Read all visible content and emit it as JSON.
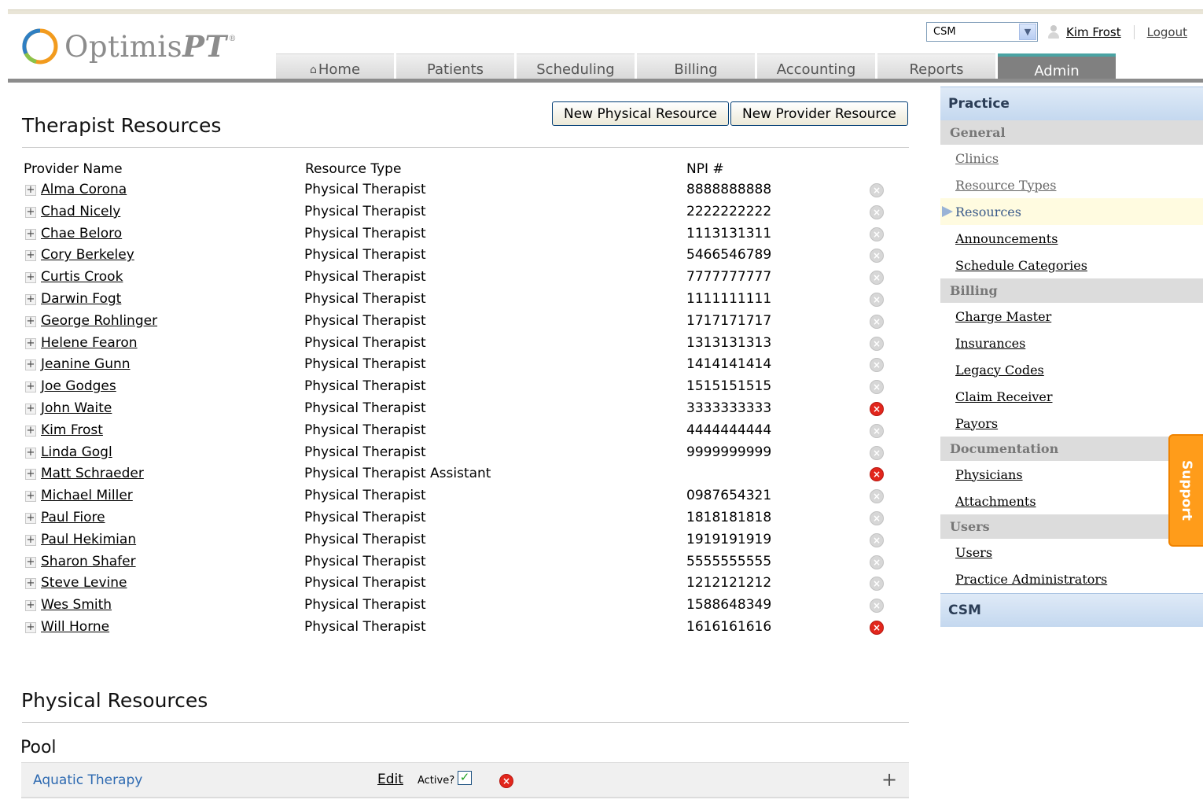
{
  "header": {
    "logo_text": "Optimis",
    "logo_text_pt": "PT",
    "logo_mark": "®",
    "csm_select_value": "CSM",
    "user_name": "Kim Frost",
    "logout_label": "Logout"
  },
  "nav": {
    "tabs": [
      {
        "label": "Home"
      },
      {
        "label": "Patients"
      },
      {
        "label": "Scheduling"
      },
      {
        "label": "Billing"
      },
      {
        "label": "Accounting"
      },
      {
        "label": "Reports"
      },
      {
        "label": "Admin"
      }
    ],
    "active": "Admin"
  },
  "therapist": {
    "title": "Therapist Resources",
    "new_physical_label": "New Physical Resource",
    "new_provider_label": "New Provider Resource",
    "col_provider": "Provider Name",
    "col_type": "Resource Type",
    "col_npi": "NPI #",
    "rows": [
      {
        "name": "Alma Corona",
        "type": "Physical Therapist",
        "npi": "8888888888",
        "active": true
      },
      {
        "name": "Chad Nicely",
        "type": "Physical Therapist",
        "npi": "2222222222",
        "active": true
      },
      {
        "name": "Chae Beloro",
        "type": "Physical Therapist",
        "npi": "1113131311",
        "active": true
      },
      {
        "name": "Cory Berkeley",
        "type": "Physical Therapist",
        "npi": "5466546789",
        "active": true
      },
      {
        "name": "Curtis Crook",
        "type": "Physical Therapist",
        "npi": "7777777777",
        "active": true
      },
      {
        "name": "Darwin Fogt",
        "type": "Physical Therapist",
        "npi": "1111111111",
        "active": true
      },
      {
        "name": "George Rohlinger",
        "type": "Physical Therapist",
        "npi": "1717171717",
        "active": true
      },
      {
        "name": "Helene Fearon",
        "type": "Physical Therapist",
        "npi": "1313131313",
        "active": true
      },
      {
        "name": "Jeanine Gunn",
        "type": "Physical Therapist",
        "npi": "1414141414",
        "active": true
      },
      {
        "name": "Joe Godges",
        "type": "Physical Therapist",
        "npi": "1515151515",
        "active": true
      },
      {
        "name": "John Waite",
        "type": "Physical Therapist",
        "npi": "3333333333",
        "active": false
      },
      {
        "name": "Kim Frost",
        "type": "Physical Therapist",
        "npi": "4444444444",
        "active": true
      },
      {
        "name": "Linda Gogl",
        "type": "Physical Therapist",
        "npi": "9999999999",
        "active": true
      },
      {
        "name": "Matt Schraeder",
        "type": "Physical Therapist Assistant",
        "npi": "",
        "active": false
      },
      {
        "name": "Michael Miller",
        "type": "Physical Therapist",
        "npi": "0987654321",
        "active": true
      },
      {
        "name": "Paul Fiore",
        "type": "Physical Therapist",
        "npi": "1818181818",
        "active": true
      },
      {
        "name": "Paul Hekimian",
        "type": "Physical Therapist",
        "npi": "1919191919",
        "active": true
      },
      {
        "name": "Sharon Shafer",
        "type": "Physical Therapist",
        "npi": "5555555555",
        "active": true
      },
      {
        "name": "Steve Levine",
        "type": "Physical Therapist",
        "npi": "1212121212",
        "active": true
      },
      {
        "name": "Wes Smith",
        "type": "Physical Therapist",
        "npi": "1588648349",
        "active": true
      },
      {
        "name": "Will Horne",
        "type": "Physical Therapist",
        "npi": "1616161616",
        "active": false
      }
    ]
  },
  "physical": {
    "title": "Physical Resources",
    "group_title": "Pool",
    "item_name": "Aquatic Therapy",
    "edit_label": "Edit",
    "active_label": "Active?"
  },
  "sidebar": {
    "practice_header": "Practice",
    "general_label": "General",
    "general_items": [
      "Clinics",
      "Resource Types",
      "Resources",
      "Announcements",
      "Schedule Categories"
    ],
    "billing_label": "Billing",
    "billing_items": [
      "Charge Master",
      "Insurances",
      "Legacy Codes",
      "Claim Receiver",
      "Payors"
    ],
    "documentation_label": "Documentation",
    "documentation_items": [
      "Physicians",
      "Attachments"
    ],
    "users_label": "Users",
    "users_items": [
      "Users",
      "Practice Administrators"
    ],
    "csm_header": "CSM"
  },
  "support_label": "Support"
}
